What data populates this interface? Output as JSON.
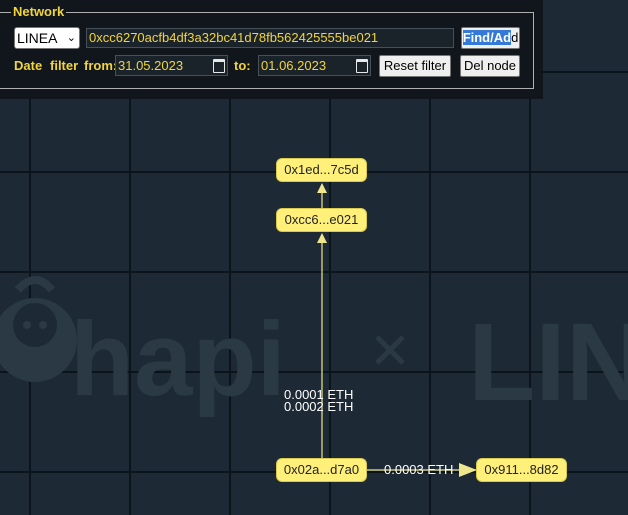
{
  "panel": {
    "legend": "Network",
    "network_value": "LINEA",
    "address_value": "0xcc6270acfb4df3a32bc41d78fb562425555be021",
    "find_button": {
      "selected_part": "Find/Ad",
      "rest": "d"
    },
    "date_label": "Date",
    "filter_label": "filter",
    "from_label": "from:",
    "from_value": "31.05.2023",
    "to_label": "to:",
    "to_value": "01.06.2023",
    "reset_button": "Reset filter",
    "del_button": "Del node"
  },
  "graph": {
    "nodes": {
      "top": "0x1ed...7c5d",
      "center": "0xcc6...e021",
      "source": "0x02a...d7a0",
      "right": "0x911...8d82"
    },
    "edges": {
      "vertical_1": "0.0001 ETH",
      "vertical_2": "0.0002 ETH",
      "horizontal": "0.0003 ETH"
    }
  },
  "watermark": {
    "left": "hapi",
    "right": "LINEA"
  },
  "colors": {
    "background": "#1d2a35",
    "accent": "#f2d43c",
    "node_fill": "#fff07a",
    "edge": "#f0e68c"
  }
}
